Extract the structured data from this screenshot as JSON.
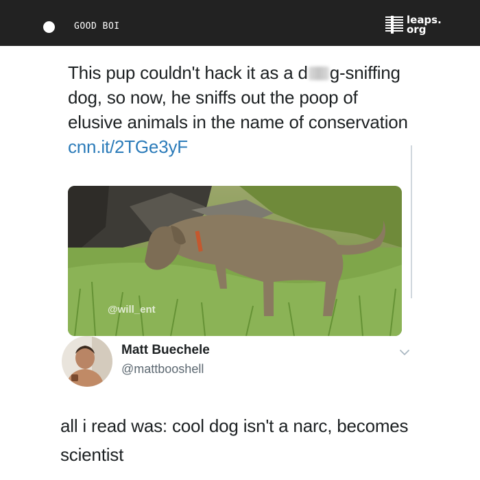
{
  "header": {
    "title": "GOOD BOI",
    "logo_line1": "leaps.",
    "logo_line2": "org",
    "background": "#222222"
  },
  "tweet": {
    "text_part1": "This pup couldn't hack it as a d",
    "text_part2": "g-sniffing dog, so now, he sniffs out the poop of elusive animals in the name of conservation ",
    "link": "cnn.it/2TGe3yF",
    "link_color": "#2b7bb9",
    "image_watermark": "@will_ent"
  },
  "reply": {
    "name": "Matt Buechele",
    "handle": "@mattbooshell",
    "text": "all i read was: cool dog isn't a narc, becomes scientist"
  },
  "icons": {
    "dot": "circle-icon",
    "logo": "striped-square-icon",
    "chevron": "chevron-down-icon"
  }
}
